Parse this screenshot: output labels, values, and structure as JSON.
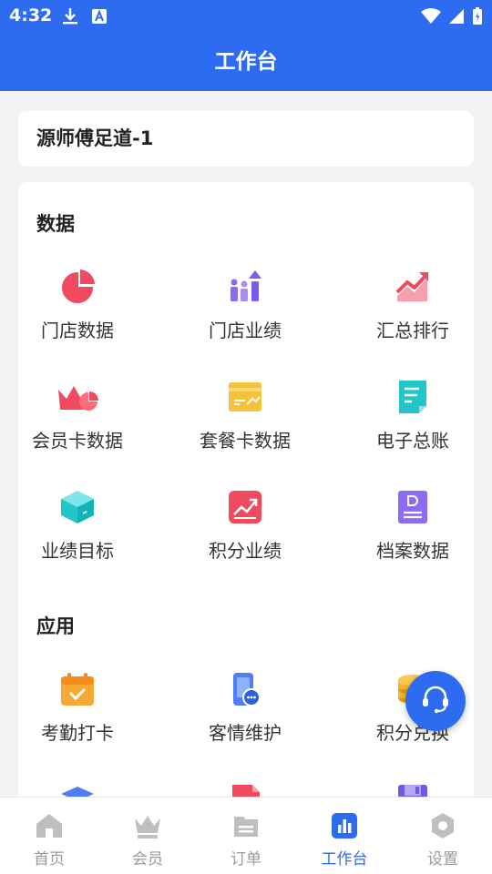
{
  "status_bar": {
    "time": "4:32"
  },
  "header": {
    "title": "工作台"
  },
  "store": {
    "name": "源师傅足道-1"
  },
  "sections": {
    "data": {
      "title": "数据",
      "items": [
        {
          "label": "门店数据",
          "icon": "pie-chart-icon"
        },
        {
          "label": "门店业绩",
          "icon": "performance-bars-icon"
        },
        {
          "label": "汇总排行",
          "icon": "trend-ranking-icon"
        },
        {
          "label": "会员卡数据",
          "icon": "crown-card-icon"
        },
        {
          "label": "套餐卡数据",
          "icon": "package-card-icon"
        },
        {
          "label": "电子总账",
          "icon": "ledger-document-icon"
        },
        {
          "label": "业绩目标",
          "icon": "target-box-icon"
        },
        {
          "label": "积分业绩",
          "icon": "points-chart-icon"
        },
        {
          "label": "档案数据",
          "icon": "archive-document-icon"
        }
      ]
    },
    "apps": {
      "title": "应用",
      "items": [
        {
          "label": "考勤打卡",
          "icon": "calendar-check-icon"
        },
        {
          "label": "客情维护",
          "icon": "phone-chat-icon"
        },
        {
          "label": "积分兑换",
          "icon": "coins-icon"
        }
      ]
    }
  },
  "bottom_nav": {
    "items": [
      {
        "label": "首页",
        "icon": "home-icon"
      },
      {
        "label": "会员",
        "icon": "crown-icon"
      },
      {
        "label": "订单",
        "icon": "order-icon"
      },
      {
        "label": "工作台",
        "icon": "workbench-icon",
        "active": true
      },
      {
        "label": "设置",
        "icon": "settings-icon"
      }
    ]
  },
  "colors": {
    "primary": "#2d6cf0",
    "background": "#f2f3f5",
    "inactive": "#9a9a9a"
  }
}
